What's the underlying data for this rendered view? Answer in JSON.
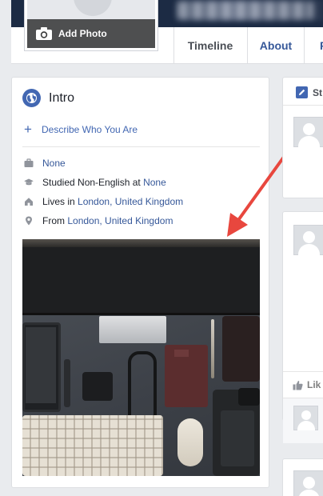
{
  "header": {
    "add_photo_label": "Add Photo",
    "tabs": [
      {
        "label": "Timeline"
      },
      {
        "label": "About"
      },
      {
        "label": "F"
      }
    ]
  },
  "intro": {
    "title": "Intro",
    "describe_label": "Describe Who You Are",
    "work": {
      "value": "None"
    },
    "study": {
      "prefix": "Studied Non-English at ",
      "link": "None"
    },
    "lives": {
      "prefix": "Lives in ",
      "link": "London, United Kingdom"
    },
    "from": {
      "prefix": "From ",
      "link": "London, United Kingdom"
    }
  },
  "status": {
    "label": "St"
  },
  "post": {
    "like_label": "Lik"
  },
  "icons": {
    "camera": "camera-icon",
    "globe": "globe-icon",
    "plus": "plus-icon",
    "briefcase": "briefcase-icon",
    "graduation": "graduation-cap-icon",
    "home": "home-icon",
    "location": "location-pin-icon",
    "edit": "edit-icon",
    "like": "thumbs-up-icon"
  },
  "colors": {
    "link": "#365899",
    "accent": "#4267b2",
    "arrow": "#e8473e",
    "background": "#e9ebee"
  }
}
